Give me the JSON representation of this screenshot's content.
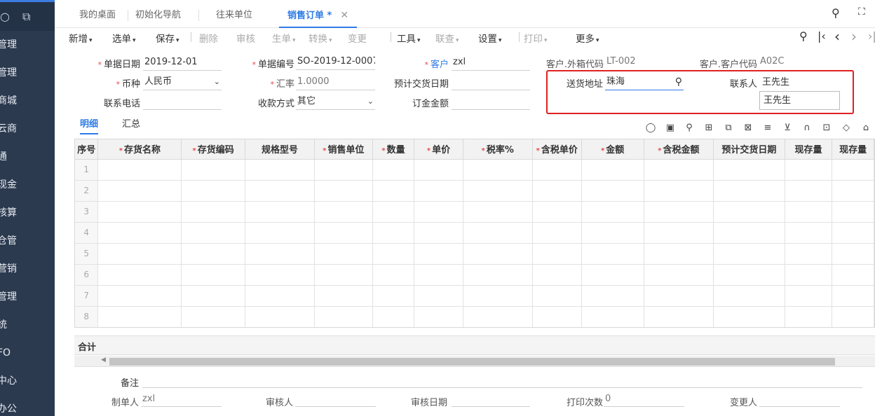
{
  "sidebar": {
    "items": [
      "管理",
      "管理",
      "商城",
      "云商",
      "通",
      "现金",
      "核算",
      "仓管",
      "营销",
      "管理",
      "统",
      "FO",
      "中心",
      "办公"
    ]
  },
  "tabs": [
    {
      "label": "我的桌面"
    },
    {
      "label": "初始化导航"
    },
    {
      "label": "往来单位"
    },
    {
      "label": "销售订单 *",
      "close": "✕",
      "active": true
    }
  ],
  "toolbar": {
    "items": [
      {
        "label": "新增",
        "caret": "▾"
      },
      {
        "label": "选单",
        "caret": "▾"
      },
      {
        "label": "保存",
        "caret": "▾"
      },
      {
        "label": "删除"
      },
      {
        "label": "审核"
      },
      {
        "label": "生单",
        "caret": "▾"
      },
      {
        "label": "转换",
        "caret": "▾"
      },
      {
        "label": "变更"
      },
      {
        "label": "工具",
        "caret": "▾"
      },
      {
        "label": "联查",
        "caret": "▾"
      },
      {
        "label": "设置",
        "caret": "▾"
      },
      {
        "label": "打印",
        "caret": "▾"
      },
      {
        "label": "更多",
        "caret": "▾"
      }
    ]
  },
  "form": {
    "doc_date_label": "单据日期",
    "doc_date": "2019-12-01",
    "doc_no_label": "单据编号",
    "doc_no": "SO-2019-12-0007",
    "customer_label": "客户",
    "customer": "zxl",
    "ext_code_label": "客户.外箱代码",
    "ext_code": "LT-002",
    "cust_code_label": "客户.客户代码",
    "cust_code": "A02C",
    "currency_label": "币种",
    "currency": "人民币",
    "rate_label": "汇率",
    "rate": "1.0000",
    "delivery_date_label": "预计交货日期",
    "delivery_date": "",
    "address_label": "送货地址",
    "address": "珠海",
    "contact_label": "联系人",
    "contact": "王先生",
    "contact_dropdown": "王先生",
    "phone_label": "联系电话",
    "phone": "",
    "payment_label": "收款方式",
    "payment": "其它",
    "deposit_label": "订金金额",
    "deposit": ""
  },
  "subtabs": [
    {
      "label": "明细",
      "active": true
    },
    {
      "label": "汇总"
    }
  ],
  "grid": {
    "columns": [
      {
        "label": "序号",
        "req": ""
      },
      {
        "label": "存货名称",
        "req": "*"
      },
      {
        "label": "存货编码",
        "req": "*"
      },
      {
        "label": "规格型号",
        "req": ""
      },
      {
        "label": "销售单位",
        "req": "*"
      },
      {
        "label": "数量",
        "req": "*"
      },
      {
        "label": "单价",
        "req": "*"
      },
      {
        "label": "税率%",
        "req": "*"
      },
      {
        "label": "含税单价",
        "req": "*"
      },
      {
        "label": "金额",
        "req": "*"
      },
      {
        "label": "含税金额",
        "req": "*"
      },
      {
        "label": "预计交货日期",
        "req": ""
      },
      {
        "label": "现存量",
        "req": ""
      },
      {
        "label": "现存量",
        "req": ""
      }
    ],
    "rows": [
      "1",
      "2",
      "3",
      "4",
      "5",
      "6",
      "7",
      "8"
    ],
    "total_label": "合计"
  },
  "footer": {
    "remark_label": "备注",
    "maker_label": "制单人",
    "maker": "zxl",
    "auditor_label": "审核人",
    "auditor": "",
    "audit_date_label": "审核日期",
    "audit_date": "",
    "print_count_label": "打印次数",
    "print_count": "0",
    "changer_label": "变更人",
    "changer": ""
  },
  "accent_color": "#2f7be5",
  "highlight_color": "#e02020"
}
